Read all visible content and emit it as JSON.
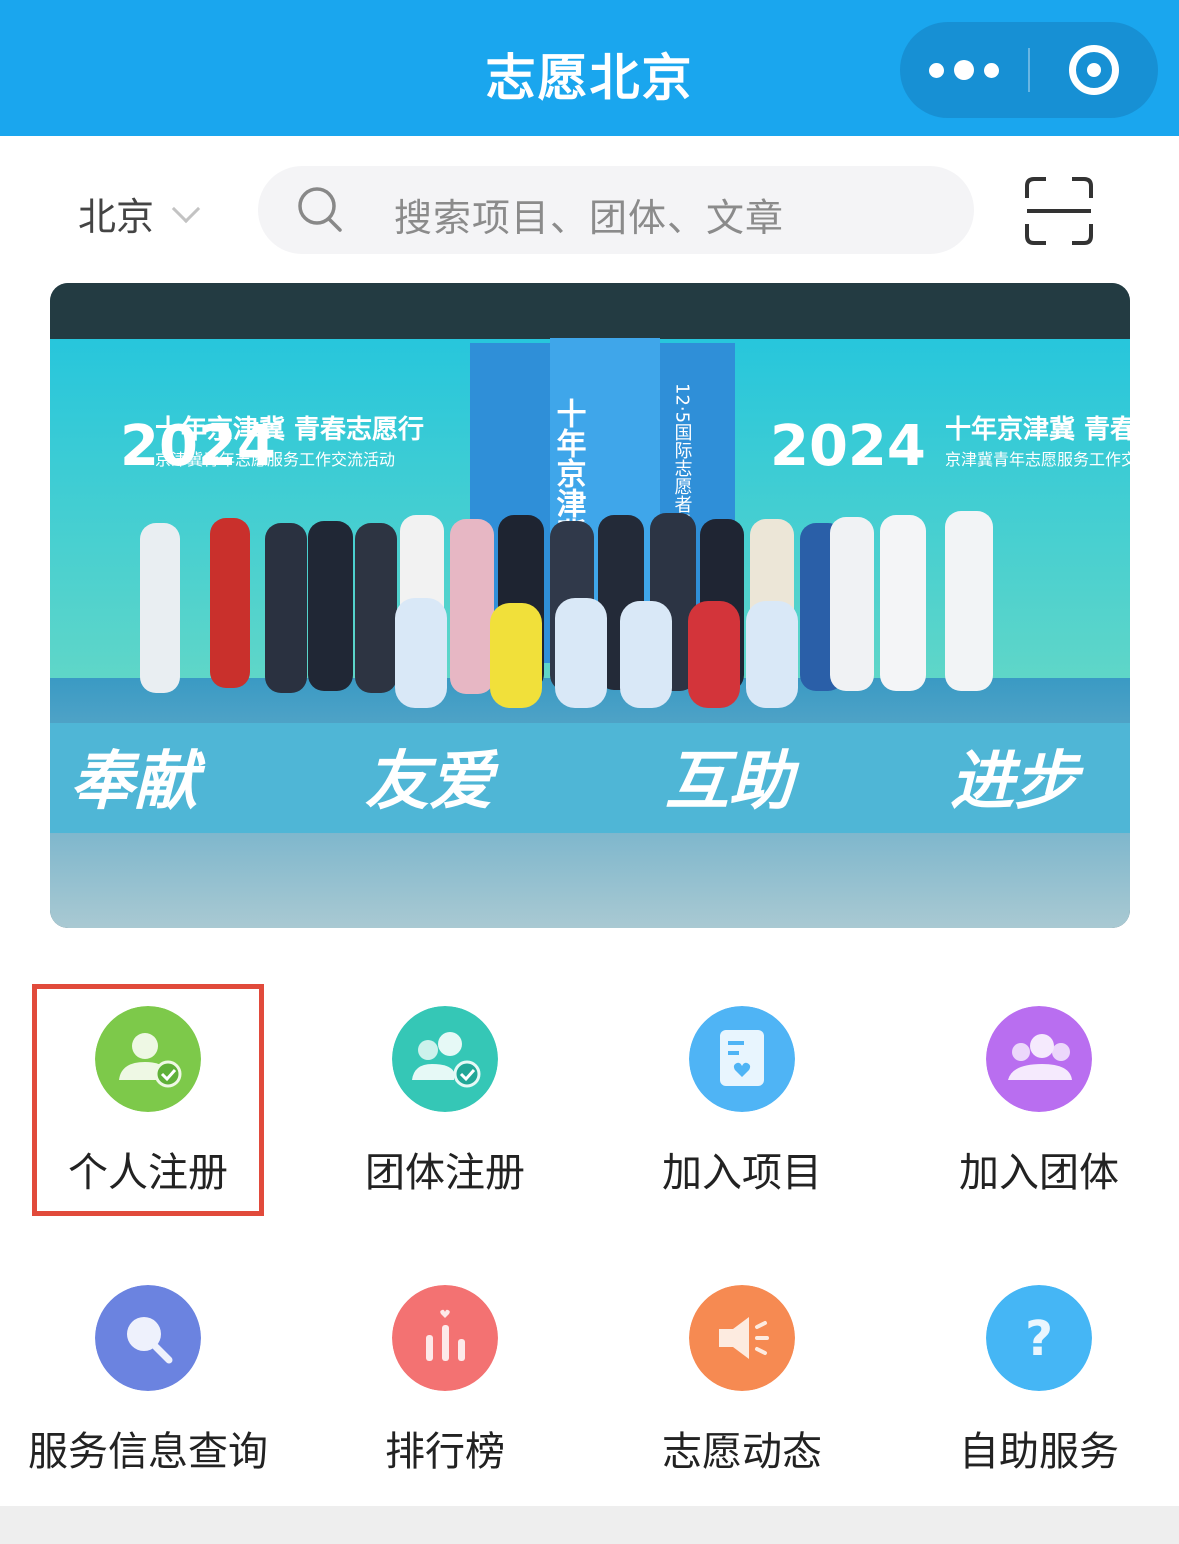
{
  "header": {
    "title": "志愿北京"
  },
  "search_bar": {
    "city": "北京",
    "placeholder": "搜索项目、团体、文章"
  },
  "banner": {
    "year": "2024",
    "headline": "十年京津冀 青春志愿行",
    "subtitle": "京津冀青年志愿服务工作交流活动",
    "center_vertical": "十年京津冀 青春",
    "side_vertical": "12·5国际志愿者日",
    "floor_words": [
      "奉献",
      "友爱",
      "互助",
      "进步"
    ]
  },
  "grid": [
    {
      "label": "个人注册",
      "icon": "person-check-icon",
      "color": "#7dc94a"
    },
    {
      "label": "团体注册",
      "icon": "group-check-icon",
      "color": "#35c7b6"
    },
    {
      "label": "加入项目",
      "icon": "document-heart-icon",
      "color": "#4fb4f5"
    },
    {
      "label": "加入团体",
      "icon": "group-join-icon",
      "color": "#b96ef0"
    },
    {
      "label": "服务信息查询",
      "icon": "search-icon",
      "color": "#6b83e0"
    },
    {
      "label": "排行榜",
      "icon": "ranking-icon",
      "color": "#f37272"
    },
    {
      "label": "志愿动态",
      "icon": "megaphone-icon",
      "color": "#f68a52"
    },
    {
      "label": "自助服务",
      "icon": "help-icon",
      "color": "#45b6f5"
    }
  ],
  "highlighted_item": "个人注册"
}
